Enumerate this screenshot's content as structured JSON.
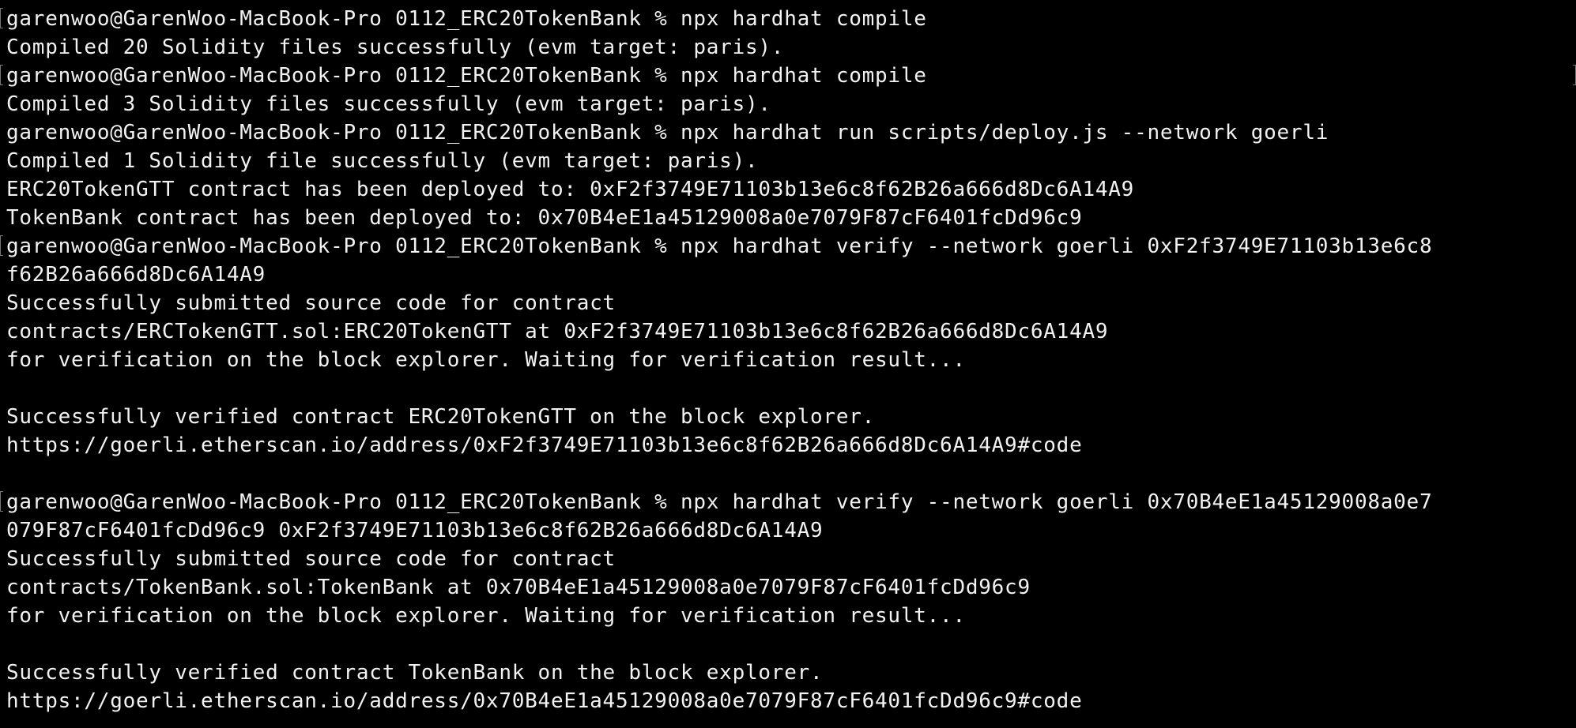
{
  "terminal": {
    "lines": [
      "garenwoo@GarenWoo-MacBook-Pro 0112_ERC20TokenBank % npx hardhat compile",
      "Compiled 20 Solidity files successfully (evm target: paris).",
      "garenwoo@GarenWoo-MacBook-Pro 0112_ERC20TokenBank % npx hardhat compile",
      "Compiled 3 Solidity files successfully (evm target: paris).",
      "garenwoo@GarenWoo-MacBook-Pro 0112_ERC20TokenBank % npx hardhat run scripts/deploy.js --network goerli",
      "Compiled 1 Solidity file successfully (evm target: paris).",
      "ERC20TokenGTT contract has been deployed to: 0xF2f3749E71103b13e6c8f62B26a666d8Dc6A14A9",
      "TokenBank contract has been deployed to: 0x70B4eE1a45129008a0e7079F87cF6401fcDd96c9",
      "garenwoo@GarenWoo-MacBook-Pro 0112_ERC20TokenBank % npx hardhat verify --network goerli 0xF2f3749E71103b13e6c8",
      "f62B26a666d8Dc6A14A9",
      "Successfully submitted source code for contract",
      "contracts/ERCTokenGTT.sol:ERC20TokenGTT at 0xF2f3749E71103b13e6c8f62B26a666d8Dc6A14A9",
      "for verification on the block explorer. Waiting for verification result...",
      "",
      "Successfully verified contract ERC20TokenGTT on the block explorer.",
      "https://goerli.etherscan.io/address/0xF2f3749E71103b13e6c8f62B26a666d8Dc6A14A9#code",
      "",
      "garenwoo@GarenWoo-MacBook-Pro 0112_ERC20TokenBank % npx hardhat verify --network goerli 0x70B4eE1a45129008a0e7",
      "079F87cF6401fcDd96c9 0xF2f3749E71103b13e6c8f62B26a666d8Dc6A14A9",
      "Successfully submitted source code for contract",
      "contracts/TokenBank.sol:TokenBank at 0x70B4eE1a45129008a0e7079F87cF6401fcDd96c9",
      "for verification on the block explorer. Waiting for verification result...",
      "",
      "Successfully verified contract TokenBank on the block explorer.",
      "https://goerli.etherscan.io/address/0x70B4eE1a45129008a0e7079F87cF6401fcDd96c9#code"
    ]
  },
  "colors": {
    "background": "#000000",
    "text": "#f2f2f2"
  }
}
